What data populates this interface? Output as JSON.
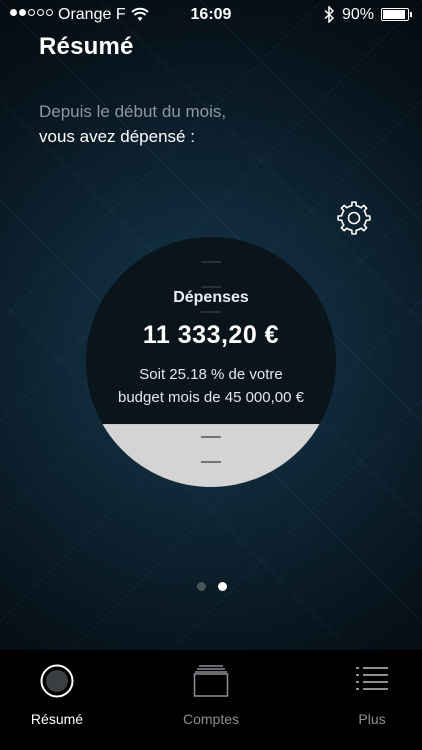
{
  "status_bar": {
    "carrier": "Orange F",
    "time": "16:09",
    "battery": "90%",
    "signal_bars_full": 2,
    "signal_bars_total": 5
  },
  "header": {
    "title": "Résumé"
  },
  "intro": {
    "line1": "Depuis le début du mois,",
    "line2": "vous avez dépensé :"
  },
  "summary": {
    "label": "Dépenses",
    "amount": "11 333,20  €",
    "line1": "Soit 25.18 % de votre",
    "line2": "budget mois de 45 000,00  €",
    "budget_used_fraction": 0.2518,
    "fill_color": "#d4d4d4"
  },
  "pager": {
    "total": 2,
    "active_index": 1
  },
  "tabbar": {
    "items": [
      {
        "label": "Résumé",
        "icon": "circle-icon",
        "active": true
      },
      {
        "label": "Comptes",
        "icon": "stacked-cards-icon",
        "active": false
      },
      {
        "label": "Plus",
        "icon": "list-icon",
        "active": false
      }
    ]
  },
  "colors": {
    "accent_bg": "#0d2230",
    "muted_text": "#8b99a3",
    "tab_inactive": "#8a9095"
  }
}
